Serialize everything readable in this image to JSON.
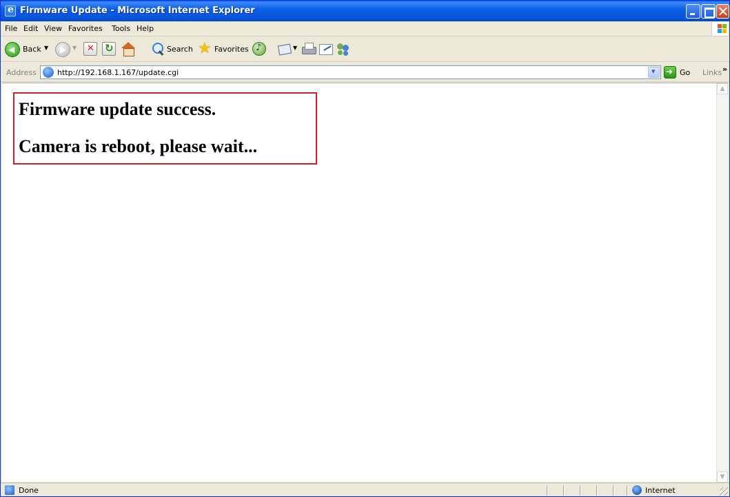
{
  "window": {
    "title": "Firmware Update - Microsoft Internet Explorer"
  },
  "menu": {
    "items": [
      "File",
      "Edit",
      "View",
      "Favorites",
      "Tools",
      "Help"
    ]
  },
  "toolbar": {
    "back_label": "Back",
    "search_label": "Search",
    "favorites_label": "Favorites"
  },
  "address": {
    "label": "Address",
    "url": "http://192.168.1.167/update.cgi",
    "go_label": "Go",
    "links_label": "Links",
    "links_chevron": "»"
  },
  "content": {
    "line1": "Firmware update success.",
    "line2": "Camera is reboot, please wait...",
    "highlight_color": "#d01f2b"
  },
  "status": {
    "text": "Done",
    "zone": "Internet"
  },
  "icons": [
    "ie-icon",
    "minimize-icon",
    "maximize-icon",
    "close-icon",
    "windows-logo-icon",
    "back-icon",
    "forward-icon",
    "stop-icon",
    "refresh-icon",
    "home-icon",
    "search-icon",
    "favorites-star-icon",
    "media-icon",
    "mail-icon",
    "print-icon",
    "edit-icon",
    "messenger-icon",
    "page-icon",
    "go-arrow-icon",
    "globe-icon"
  ]
}
